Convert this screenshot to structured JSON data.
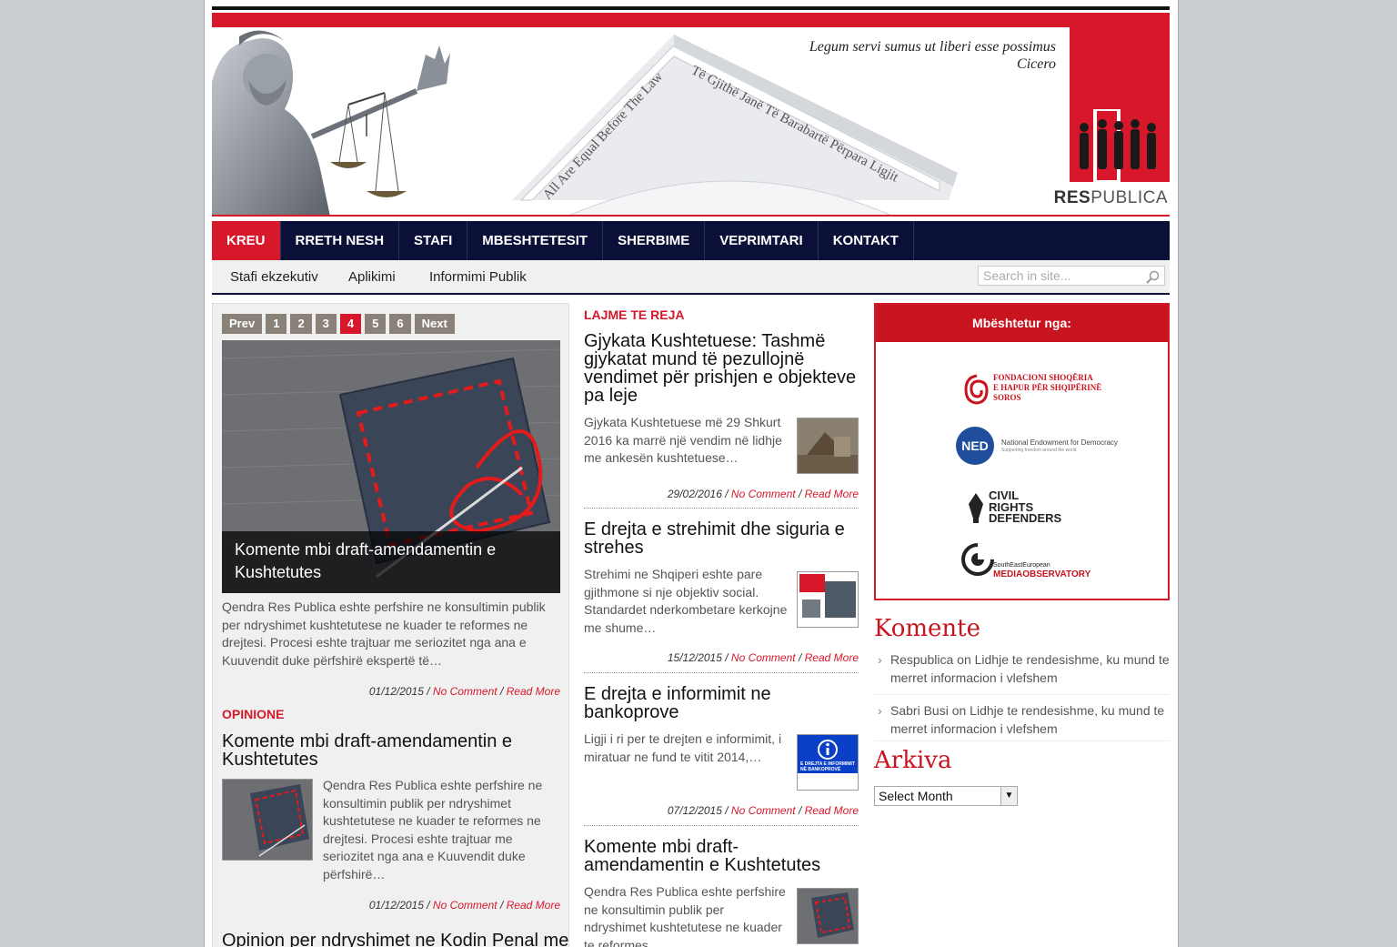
{
  "header": {
    "motto_line1": "Legum servi sumus ut liberi esse possimus",
    "motto_line2": "Cicero",
    "pediment_text_left": "All Are Equal Before The Law",
    "pediment_text_right": "Të Gjithë Janë Të Barabartë Përpara Ligjit",
    "logo_bold": "RES",
    "logo_rest": "PUBLICA"
  },
  "nav": {
    "items": [
      "KREU",
      "RRETH NESH",
      "STAFI",
      "MBESHTETESIT",
      "SHERBIME",
      "VEPRIMTARI",
      "KONTAKT"
    ],
    "active": "KREU"
  },
  "subnav": {
    "items": [
      "Stafi ekzekutiv",
      "Aplikimi",
      "Informimi Publik"
    ],
    "search_placeholder": "Search in site..."
  },
  "slider": {
    "pager": [
      "Prev",
      "1",
      "2",
      "3",
      "4",
      "5",
      "6",
      "Next"
    ],
    "current": "4",
    "caption": "Komente mbi draft-amendamentin e Kushtetutes",
    "excerpt": "Qendra Res Publica eshte perfshire ne konsultimin publik per ndryshimet kushtetutese ne kuader te reformes ne drejtesi. Procesi eshte trajtuar me seriozitet nga ana e Kuuvendit duke përfshirë ekspertë të…",
    "date": "01/12/2015",
    "comment_link": "No Comment",
    "read_more": "Read More"
  },
  "opinione": {
    "label": "OPINIONE",
    "posts": [
      {
        "title": "Komente mbi draft-amendamentin e Kushtetutes",
        "excerpt": "Qendra Res Publica eshte perfshire ne konsultimin publik per ndryshimet kushtetutese ne kuader te reformes ne drejtesi. Procesi eshte trajtuar me seriozitet nga ana e Kuuvendit duke përfshirë…",
        "date": "01/12/2015",
        "comment_link": "No Comment",
        "read_more": "Read More"
      },
      {
        "title": "Opinion per ndryshimet ne Kodin Penal me"
      }
    ]
  },
  "news": {
    "label": "LAJME TE REJA",
    "posts": [
      {
        "title": "Gjykata Kushtetuese: Tashmë gjykatat mund të pezullojnë vendimet për prishjen e objekteve pa leje",
        "excerpt": "Gjykata Kushtetuese më 29 Shkurt 2016 ka marrë një vendim në lidhje me ankesën kushtetuese…",
        "date": "29/02/2016",
        "comment_link": "No Comment",
        "read_more": "Read More"
      },
      {
        "title": "E drejta e strehimit dhe siguria e strehes",
        "excerpt": "Strehimi ne Shqiperi eshte pare gjithmone si nje objektiv social. Standardet nderkombetare kerkojne me shume…",
        "date": "15/12/2015",
        "comment_link": "No Comment",
        "read_more": "Read More"
      },
      {
        "title": "E drejta e informimit ne bankoprove",
        "excerpt": "Ligji i ri per te drejten e informimit, i miratuar ne fund te vitit 2014,…",
        "date": "07/12/2015",
        "comment_link": "No Comment",
        "read_more": "Read More",
        "thumb_text": "E DREJTA E INFORMIMIT NË BANKOPROVË"
      },
      {
        "title": "Komente mbi draft-amendamentin e Kushtetutes",
        "excerpt": "Qendra Res Publica eshte perfshire ne konsultimin publik per ndryshimet kushtetutese ne kuader te reformes…"
      }
    ]
  },
  "sponsors": {
    "title": "Mbështetur nga:",
    "items": [
      {
        "line1": "FONDACIONI SHOQËRIA",
        "line2": "E HAPUR PËR SHQIPËRINË",
        "line3": "SOROS"
      },
      {
        "abbr": "NED",
        "name": "National Endowment for Democracy",
        "tagline": "Supporting freedom around the world"
      },
      {
        "line1": "CIVIL",
        "line2": "RIGHTS",
        "line3": "DEFENDERS"
      },
      {
        "line1": "SouthEastEuropean",
        "line2": "MEDIAOBSERVATORY"
      }
    ]
  },
  "comments_widget": {
    "title": "Komente",
    "items": [
      {
        "author": "Respublica",
        "on": "on",
        "post": "Lidhje te rendesishme, ku mund te merret informacion i vlefshem"
      },
      {
        "author": "Sabri Busi",
        "on": "on",
        "post": "Lidhje te rendesishme, ku mund te merret informacion i vlefshem"
      }
    ]
  },
  "archive_widget": {
    "title": "Arkiva",
    "select_value": "Select Month"
  },
  "colors": {
    "brand_red": "#d7182a",
    "nav_navy": "#0b1038",
    "page_bg": "#c9ced3"
  }
}
